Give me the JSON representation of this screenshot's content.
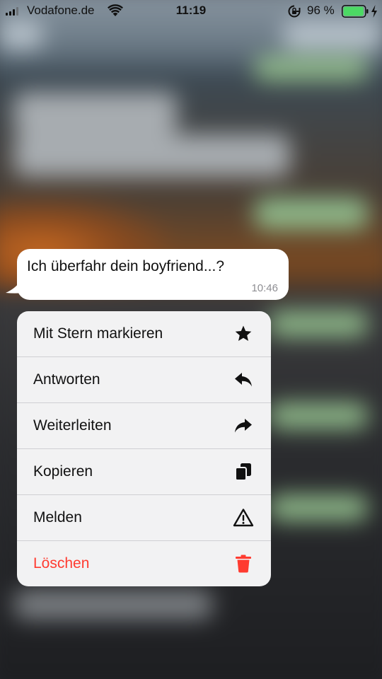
{
  "status_bar": {
    "carrier": "Vodafone.de",
    "time": "11:19",
    "battery_percent": "96 %",
    "battery_level": 0.96,
    "battery_color": "#4cd964",
    "signal_bars": 3,
    "icons": [
      "signal-icon",
      "wifi-icon",
      "rotation-lock-icon",
      "battery-icon",
      "charging-icon"
    ]
  },
  "message": {
    "text": "Ich überfahr dein boyfriend...?",
    "time": "10:46"
  },
  "context_menu": {
    "items": [
      {
        "label": "Mit Stern markieren",
        "icon": "star-icon"
      },
      {
        "label": "Antworten",
        "icon": "reply-icon"
      },
      {
        "label": "Weiterleiten",
        "icon": "forward-icon"
      },
      {
        "label": "Kopieren",
        "icon": "copy-icon"
      },
      {
        "label": "Melden",
        "icon": "warning-icon"
      },
      {
        "label": "Löschen",
        "icon": "trash-icon",
        "destructive": true
      }
    ],
    "destructive_color": "#ff3b30"
  }
}
